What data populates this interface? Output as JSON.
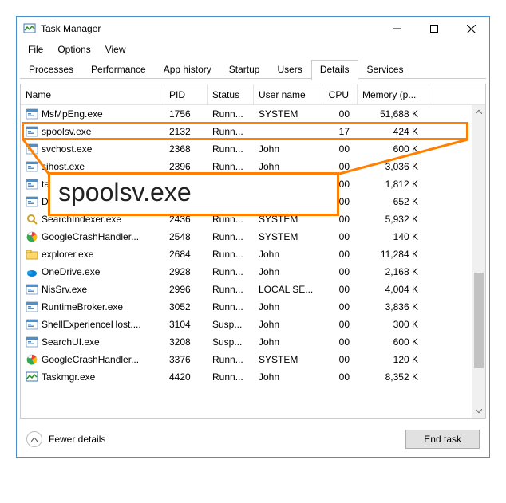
{
  "window": {
    "title": "Task Manager"
  },
  "menubar": [
    "File",
    "Options",
    "View"
  ],
  "tabs": [
    "Processes",
    "Performance",
    "App history",
    "Startup",
    "Users",
    "Details",
    "Services"
  ],
  "active_tab": 5,
  "headers": {
    "name": "Name",
    "pid": "PID",
    "status": "Status",
    "user": "User name",
    "cpu": "CPU",
    "mem": "Memory (p..."
  },
  "rows": [
    {
      "icon": "proc",
      "name": "MsMpEng.exe",
      "pid": "1756",
      "status": "Runn...",
      "user": "SYSTEM",
      "cpu": "00",
      "mem": "51,688 K"
    },
    {
      "icon": "proc",
      "name": "spoolsv.exe",
      "pid": "2132",
      "status": "Runn...",
      "user": "",
      "cpu": "17",
      "mem": "424 K"
    },
    {
      "icon": "proc",
      "name": "svchost.exe",
      "pid": "2368",
      "status": "Runn...",
      "user": "John",
      "cpu": "00",
      "mem": "600 K"
    },
    {
      "icon": "proc",
      "name": "sihost.exe",
      "pid": "2396",
      "status": "Runn...",
      "user": "John",
      "cpu": "00",
      "mem": "3,036 K"
    },
    {
      "icon": "proc",
      "name": "ta",
      "pid": "",
      "status": "",
      "user": "",
      "cpu": "00",
      "mem": "1,812 K"
    },
    {
      "icon": "proc",
      "name": "D",
      "pid": "",
      "status": "",
      "user": "",
      "cpu": "00",
      "mem": "652 K"
    },
    {
      "icon": "search",
      "name": "SearchIndexer.exe",
      "pid": "2436",
      "status": "Runn...",
      "user": "SYSTEM",
      "cpu": "00",
      "mem": "5,932 K"
    },
    {
      "icon": "google",
      "name": "GoogleCrashHandler...",
      "pid": "2548",
      "status": "Runn...",
      "user": "SYSTEM",
      "cpu": "00",
      "mem": "140 K"
    },
    {
      "icon": "explorer",
      "name": "explorer.exe",
      "pid": "2684",
      "status": "Runn...",
      "user": "John",
      "cpu": "00",
      "mem": "11,284 K"
    },
    {
      "icon": "onedrive",
      "name": "OneDrive.exe",
      "pid": "2928",
      "status": "Runn...",
      "user": "John",
      "cpu": "00",
      "mem": "2,168 K"
    },
    {
      "icon": "proc",
      "name": "NisSrv.exe",
      "pid": "2996",
      "status": "Runn...",
      "user": "LOCAL SE...",
      "cpu": "00",
      "mem": "4,004 K"
    },
    {
      "icon": "proc",
      "name": "RuntimeBroker.exe",
      "pid": "3052",
      "status": "Runn...",
      "user": "John",
      "cpu": "00",
      "mem": "3,836 K"
    },
    {
      "icon": "proc",
      "name": "ShellExperienceHost....",
      "pid": "3104",
      "status": "Susp...",
      "user": "John",
      "cpu": "00",
      "mem": "300 K"
    },
    {
      "icon": "proc",
      "name": "SearchUI.exe",
      "pid": "3208",
      "status": "Susp...",
      "user": "John",
      "cpu": "00",
      "mem": "600 K"
    },
    {
      "icon": "google",
      "name": "GoogleCrashHandler...",
      "pid": "3376",
      "status": "Runn...",
      "user": "SYSTEM",
      "cpu": "00",
      "mem": "120 K"
    },
    {
      "icon": "taskmgr",
      "name": "Taskmgr.exe",
      "pid": "4420",
      "status": "Runn...",
      "user": "John",
      "cpu": "00",
      "mem": "8,352 K"
    }
  ],
  "footer": {
    "fewer": "Fewer details",
    "end_task": "End task"
  },
  "callout": {
    "text": "spoolsv.exe"
  }
}
